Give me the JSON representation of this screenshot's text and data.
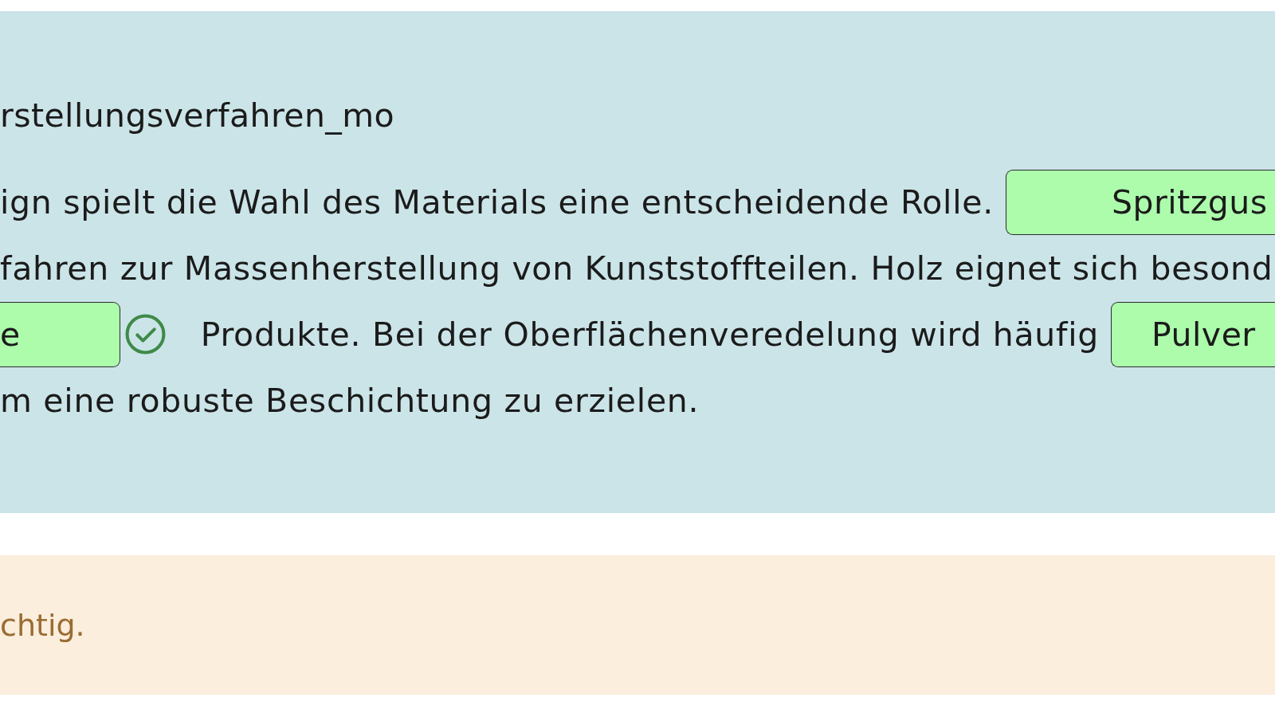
{
  "exercise": {
    "title": "rstellungsverfahren_mo",
    "lines": [
      {
        "segments": [
          {
            "kind": "text",
            "text": "ign spielt die Wahl des Materials eine entscheidende Rolle."
          },
          {
            "kind": "gap",
            "value": "Spritzgus",
            "correct": true
          }
        ]
      },
      {
        "segments": [
          {
            "kind": "text",
            "text": "fahren zur Massenherstellung von Kunststoffteilen. Holz eignet sich besond"
          }
        ]
      },
      {
        "segments": [
          {
            "kind": "gap",
            "value": "e",
            "correct": true
          },
          {
            "kind": "result",
            "correct": true
          },
          {
            "kind": "text",
            "text": "Produkte. Bei der Oberflächenveredelung wird häufig"
          },
          {
            "kind": "gap",
            "value": "Pulver",
            "correct": true
          }
        ]
      },
      {
        "segments": [
          {
            "kind": "text",
            "text": "m eine robuste Beschichtung zu erzielen."
          }
        ]
      }
    ]
  },
  "feedback": {
    "kind": "warning",
    "text": "chtig."
  }
}
